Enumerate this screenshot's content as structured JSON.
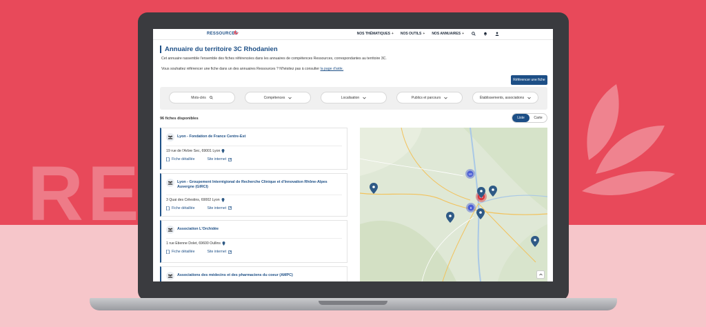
{
  "background": {
    "word": "RES",
    "top_color": "#e8495a",
    "bottom_color": "#f6c6ca"
  },
  "nav": {
    "logo": "RESSOURCES",
    "items": [
      {
        "label": "NOS THÉMATIQUES",
        "plus": "+"
      },
      {
        "label": "NOS OUTILS",
        "plus": "+"
      },
      {
        "label": "NOS ANNUAIRES",
        "plus": "+"
      }
    ],
    "icons": [
      "search-icon",
      "bell-icon",
      "user-icon"
    ]
  },
  "page": {
    "title": "Annuaire du territoire 3C Rhodanien",
    "description": "Cet annuaire rassemble l'ensemble des fiches référencées dans les annuaires de compétences Ressources, correspondantes au territoire 3C.",
    "help_text": "Vous souhaitez référencer une fiche dans un des annuaires Ressources ? N'hésitez pas à consulter",
    "help_link": "la page d'aide.",
    "reference_button": "Référencer une fiche"
  },
  "filters": {
    "keywords_placeholder": "Mots-clés",
    "dropdowns": [
      "Compétences",
      "Localisation",
      "Publics et parcours",
      "Établissements, associations"
    ]
  },
  "results": {
    "count": "96 fiches disponibles",
    "view_list": "Liste",
    "view_map": "Carte"
  },
  "cards": [
    {
      "name": "Lyon - Fondation de France Centre-Est",
      "address": "19 rue de l'Arbre Sec, 69001 Lyon",
      "link1": "Fiche détaillée",
      "link2": "Site internet"
    },
    {
      "name": "Lyon - Groupement Interrégional de Recherche Clinique et d'Innovation Rhône-Alpes Auvergne (GIRCI)",
      "address": "3 Quai des Célestins, 69002 Lyon",
      "link1": "Fiche détaillée",
      "link2": "Site internet"
    },
    {
      "name": "Association L'Orchidée",
      "address": "1 rue Etienne Dolet, 69600 Oullins",
      "link1": "Fiche détaillée",
      "link2": "Site internet"
    },
    {
      "name": "Associations des médecins et des pharmaciens du coeur (AMPC)",
      "address": "",
      "link1": "",
      "link2": ""
    }
  ],
  "map": {
    "cluster_small": "10",
    "cluster_red": "56",
    "cluster_mid": "8",
    "colors": {
      "marker": "#2f5a86",
      "cluster_blue": "#4c5fd5",
      "cluster_red": "#d9363e",
      "land": "#dfe8d6"
    }
  }
}
